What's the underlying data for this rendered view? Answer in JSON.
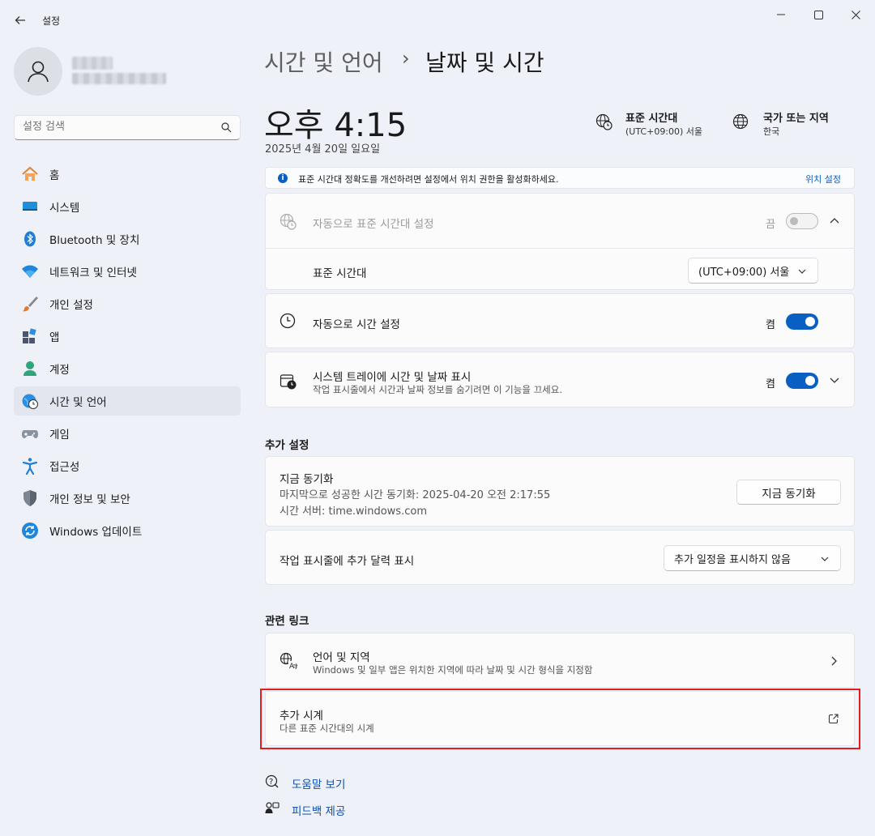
{
  "window": {
    "title": "설정"
  },
  "sidebar": {
    "search_placeholder": "설정 검색",
    "items": [
      {
        "label": "홈",
        "icon": "home-icon"
      },
      {
        "label": "시스템",
        "icon": "system-icon"
      },
      {
        "label": "Bluetooth 및 장치",
        "icon": "bluetooth-icon"
      },
      {
        "label": "네트워크 및 인터넷",
        "icon": "wifi-icon"
      },
      {
        "label": "개인 설정",
        "icon": "brush-icon"
      },
      {
        "label": "앱",
        "icon": "apps-icon"
      },
      {
        "label": "계정",
        "icon": "account-icon"
      },
      {
        "label": "시간 및 언어",
        "icon": "time-language-icon"
      },
      {
        "label": "게임",
        "icon": "gamepad-icon"
      },
      {
        "label": "접근성",
        "icon": "accessibility-icon"
      },
      {
        "label": "개인 정보 및 보안",
        "icon": "shield-icon"
      },
      {
        "label": "Windows 업데이트",
        "icon": "update-icon"
      }
    ]
  },
  "header": {
    "breadcrumb_parent": "시간 및 언어",
    "breadcrumb_separator": "›",
    "breadcrumb_current": "날짜 및 시간"
  },
  "clock": {
    "time": "오후 4:15",
    "date": "2025년 4월 20일 일요일"
  },
  "timezone_summary": {
    "title": "표준 시간대",
    "value": "(UTC+09:00) 서울"
  },
  "region_summary": {
    "title": "국가 또는 지역",
    "value": "한국"
  },
  "info_bar": {
    "text": "표준 시간대 정확도를 개선하려면 설정에서 위치 권한을 활성화하세요.",
    "link": "위치 설정"
  },
  "auto_timezone": {
    "label": "자동으로 표준 시간대 설정",
    "state": "끔"
  },
  "timezone_row": {
    "label": "표준 시간대",
    "value": "(UTC+09:00) 서울"
  },
  "auto_time": {
    "label": "자동으로 시간 설정",
    "state": "켬"
  },
  "tray_time": {
    "label": "시스템 트레이에 시간 및 날짜 표시",
    "description": "작업 표시줄에서 시간과 날짜 정보를 숨기려면 이 기능을 끄세요.",
    "state": "켬"
  },
  "additional_settings": {
    "heading": "추가 설정",
    "sync": {
      "title": "지금 동기화",
      "last_sync": "마지막으로 성공한 시간 동기화: 2025-04-20 오전 2:17:55",
      "server": "시간 서버: time.windows.com",
      "button": "지금 동기화"
    },
    "calendar": {
      "label": "작업 표시줄에 추가 달력 표시",
      "value": "추가 일정을 표시하지 않음"
    }
  },
  "related_links": {
    "heading": "관련 링크",
    "language_region": {
      "title": "언어 및 지역",
      "description": "Windows 및 일부 앱은 위치한 지역에 따라 날짜 및 시간 형식을 지정함"
    },
    "additional_clocks": {
      "title": "추가 시계",
      "description": "다른 표준 시간대의 시계"
    }
  },
  "footer": {
    "help": "도움말 보기",
    "feedback": "피드백 제공"
  },
  "colors": {
    "accent": "#0a5fc2",
    "highlight": "#e01e1e",
    "background": "#eef1f8"
  }
}
